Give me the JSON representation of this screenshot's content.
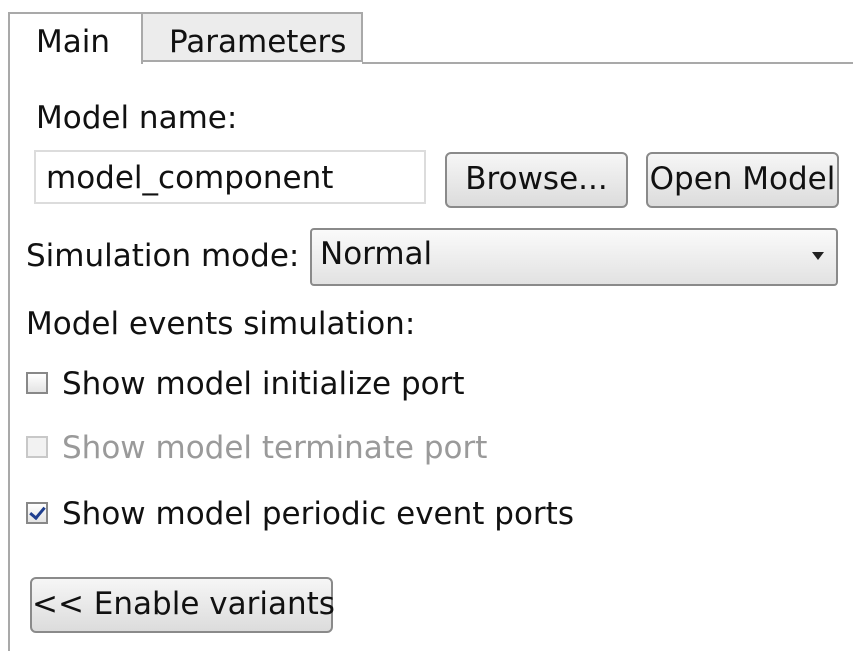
{
  "tabs": [
    {
      "label": "Main",
      "active": true
    },
    {
      "label": "Parameters",
      "active": false
    }
  ],
  "model": {
    "name_label": "Model name:",
    "name_value": "model_component",
    "browse_label": "Browse...",
    "open_label": "Open Model"
  },
  "simulation": {
    "mode_label": "Simulation mode:",
    "mode_value": "Normal"
  },
  "events": {
    "heading": "Model events simulation:",
    "checkboxes": [
      {
        "label": "Show model initialize port",
        "checked": false,
        "enabled": true
      },
      {
        "label": "Show model terminate port",
        "checked": false,
        "enabled": false
      },
      {
        "label": "Show model periodic event ports",
        "checked": true,
        "enabled": true
      }
    ]
  },
  "variants_button": "<< Enable variants",
  "colors": {
    "border": "#a9a9a9",
    "inactive_tab": "#ececec",
    "check_mark": "#1f3f8f",
    "disabled_text": "#9a9a9a"
  }
}
